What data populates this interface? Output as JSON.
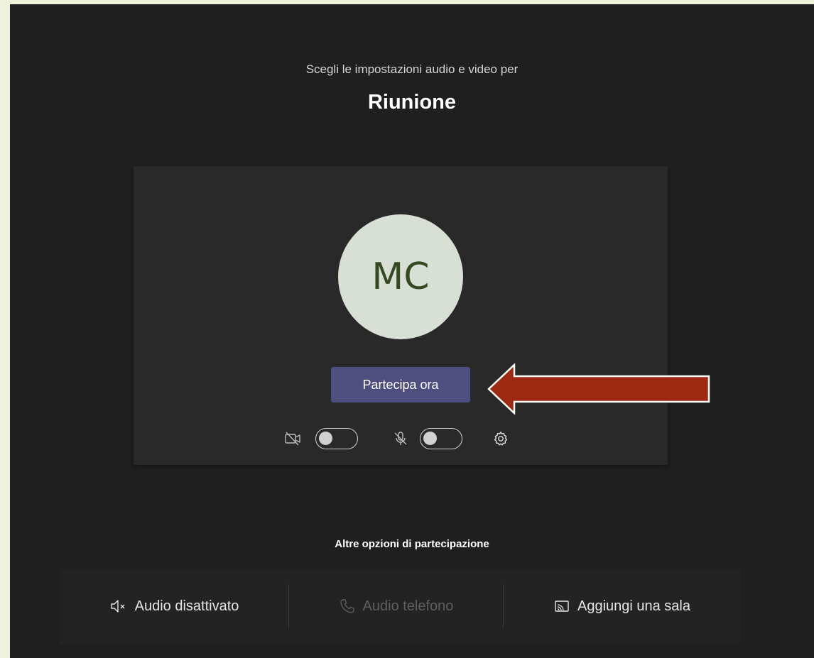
{
  "header": {
    "subtitle": "Scegli le impostazioni audio e video per",
    "meeting_title": "Riunione"
  },
  "preview": {
    "avatar_initials": "MC",
    "join_button": "Partecipa ora",
    "camera_toggle": {
      "icon": "camera-off-icon",
      "state": "off"
    },
    "mic_toggle": {
      "icon": "mic-off-icon",
      "state": "off"
    },
    "settings_icon": "gear-icon"
  },
  "other_options": {
    "title": "Altre opzioni di partecipazione",
    "items": [
      {
        "label": "Audio disattivato",
        "icon": "speaker-off-icon",
        "enabled": true
      },
      {
        "label": "Audio telefono",
        "icon": "phone-icon",
        "enabled": false
      },
      {
        "label": "Aggiungi una sala",
        "icon": "cast-icon",
        "enabled": true
      }
    ]
  },
  "annotation": {
    "arrow_color": "#9c2a12"
  },
  "colors": {
    "page_background": "#eef2dc",
    "app_background": "#1f1f1f",
    "preview_background": "#292929",
    "join_button": "#4e4e7f",
    "avatar_background": "#d8dfd4",
    "avatar_text": "#354a22"
  }
}
